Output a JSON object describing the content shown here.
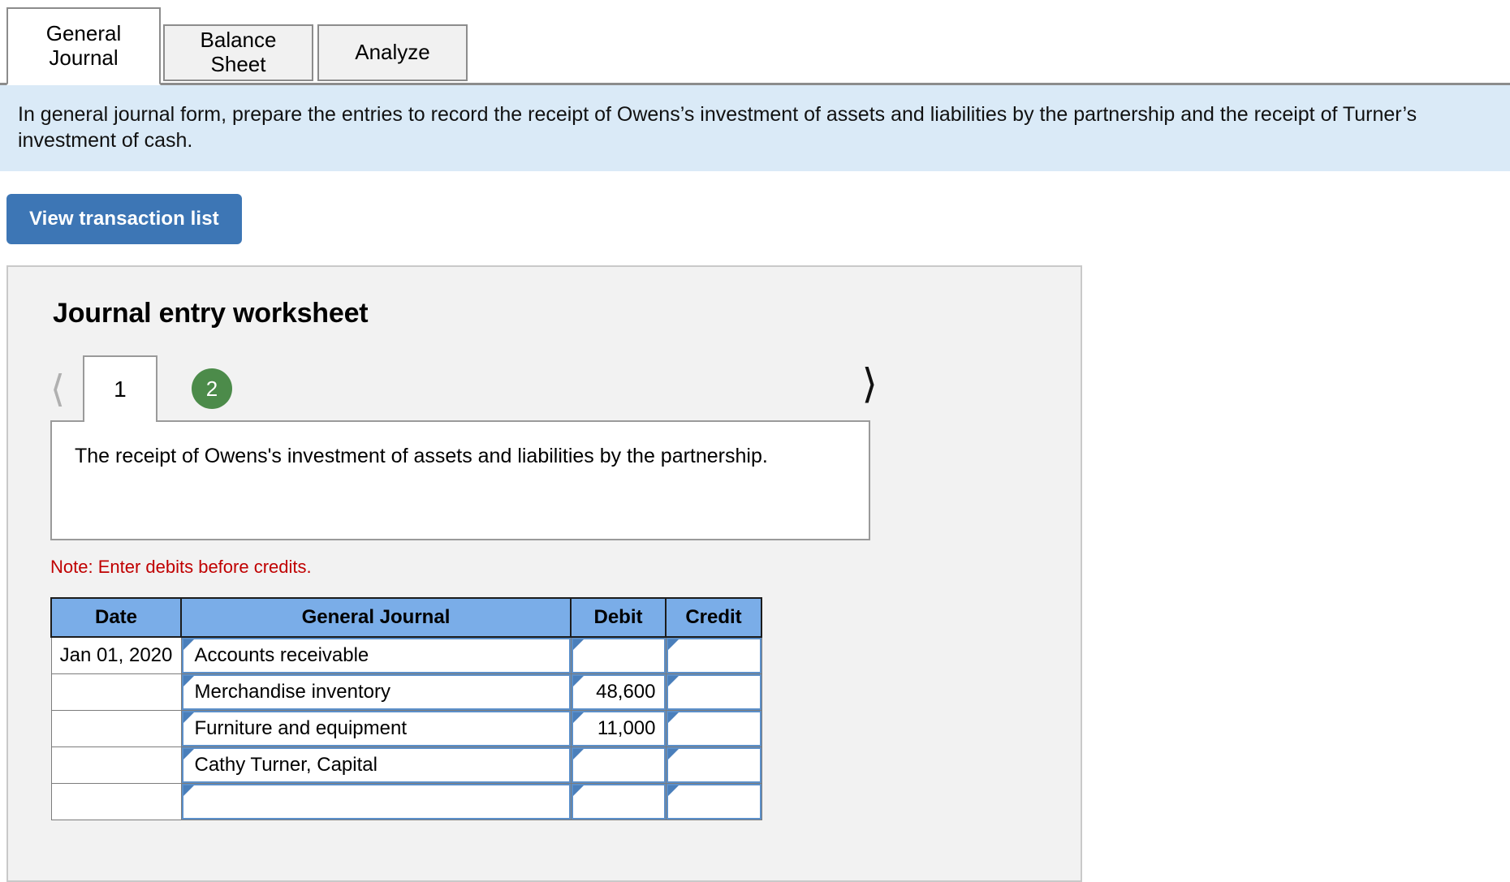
{
  "tabs": [
    {
      "label": "General\nJournal",
      "active": true
    },
    {
      "label": "Balance Sheet",
      "active": false
    },
    {
      "label": "Analyze",
      "active": false
    }
  ],
  "tab_labels": {
    "general_journal_line1": "General",
    "general_journal_line2": "Journal",
    "balance_sheet": "Balance Sheet",
    "analyze": "Analyze"
  },
  "banner": {
    "text": "In general journal form, prepare the entries to record the receipt of Owens’s investment of assets and liabilities by the partnership and the receipt of Turner’s investment of cash."
  },
  "toolbar": {
    "view_transaction_list_label": "View transaction list"
  },
  "worksheet": {
    "title": "Journal entry worksheet",
    "pager": {
      "prev_icon": "chevron-left-icon",
      "next_icon": "chevron-right-icon",
      "pages": [
        {
          "label": "1",
          "state": "active"
        },
        {
          "label": "2",
          "state": "badge"
        }
      ]
    },
    "description": "The receipt of Owens's investment of assets and liabilities by the partnership.",
    "note": "Note: Enter debits before credits.",
    "table": {
      "columns": [
        "Date",
        "General Journal",
        "Debit",
        "Credit"
      ],
      "rows": [
        {
          "date": "Jan 01, 2020",
          "account": "Accounts receivable",
          "debit": "",
          "credit": ""
        },
        {
          "date": "",
          "account": "Merchandise inventory",
          "debit": "48,600",
          "credit": ""
        },
        {
          "date": "",
          "account": "Furniture and equipment",
          "debit": "11,000",
          "credit": ""
        },
        {
          "date": "",
          "account": "Cathy Turner, Capital",
          "debit": "",
          "credit": ""
        },
        {
          "date": "",
          "account": "",
          "debit": "",
          "credit": ""
        }
      ]
    }
  },
  "colors": {
    "banner_bg": "#daeaf7",
    "primary_button": "#3d76b5",
    "table_header_blue": "#7aade8",
    "badge_green": "#4c8b4a",
    "note_red": "#c00000",
    "cell_border_blue": "#5b8fc9"
  }
}
